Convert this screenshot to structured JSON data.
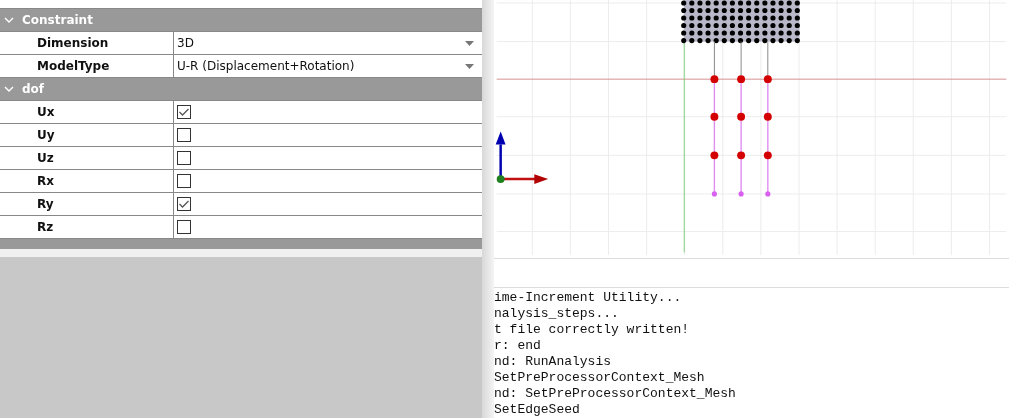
{
  "property_groups": [
    {
      "title": "Constraint",
      "expanded": true,
      "rows": [
        {
          "kind": "dropdown",
          "label": "Dimension",
          "value": "3D"
        },
        {
          "kind": "dropdown",
          "label": "ModelType",
          "value": "U-R (Displacement+Rotation)"
        }
      ]
    },
    {
      "title": "dof",
      "expanded": true,
      "rows": [
        {
          "kind": "checkbox",
          "label": "Ux",
          "checked": true
        },
        {
          "kind": "checkbox",
          "label": "Uy",
          "checked": false
        },
        {
          "kind": "checkbox",
          "label": "Uz",
          "checked": false
        },
        {
          "kind": "checkbox",
          "label": "Rx",
          "checked": false
        },
        {
          "kind": "checkbox",
          "label": "Ry",
          "checked": true
        },
        {
          "kind": "checkbox",
          "label": "Rz",
          "checked": false
        }
      ]
    }
  ],
  "console": {
    "lines": [
      "ime-Increment Utility...",
      "nalysis_steps...",
      "t file correctly written!",
      "r: end",
      "nd: RunAnalysis",
      "SetPreProcessorContext_Mesh",
      "nd: SetPreProcessorContext_Mesh",
      "SetEdgeSeed"
    ]
  }
}
